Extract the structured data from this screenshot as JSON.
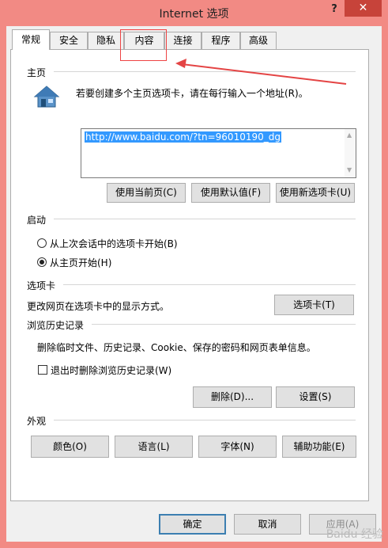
{
  "window": {
    "title": "Internet 选项",
    "help": "?",
    "close": "✕"
  },
  "tabs": [
    {
      "label": "常规"
    },
    {
      "label": "安全"
    },
    {
      "label": "隐私"
    },
    {
      "label": "内容"
    },
    {
      "label": "连接"
    },
    {
      "label": "程序"
    },
    {
      "label": "高级"
    }
  ],
  "home": {
    "section": "主页",
    "instruction": "若要创建多个主页选项卡，请在每行输入一个地址(R)。",
    "url": "http://www.baidu.com/?tn=96010190_dg",
    "btn_current": "使用当前页(C)",
    "btn_default": "使用默认值(F)",
    "btn_newtab": "使用新选项卡(U)"
  },
  "startup": {
    "section": "启动",
    "opt_last": "从上次会话中的选项卡开始(B)",
    "opt_home": "从主页开始(H)"
  },
  "tabs_section": {
    "section": "选项卡",
    "desc": "更改网页在选项卡中的显示方式。",
    "btn": "选项卡(T)"
  },
  "history": {
    "section": "浏览历史记录",
    "desc": "删除临时文件、历史记录、Cookie、保存的密码和网页表单信息。",
    "checkbox": "退出时删除浏览历史记录(W)",
    "btn_delete": "删除(D)...",
    "btn_settings": "设置(S)"
  },
  "appearance": {
    "section": "外观",
    "btn_colors": "颜色(O)",
    "btn_languages": "语言(L)",
    "btn_fonts": "字体(N)",
    "btn_accessibility": "辅助功能(E)"
  },
  "footer": {
    "ok": "确定",
    "cancel": "取消",
    "apply": "应用(A)"
  },
  "watermark": "Baidu 经验",
  "colors": {
    "frame": "#f28a84",
    "close": "#c7433a",
    "selection": "#3399ff",
    "annotation": "#e44444"
  }
}
